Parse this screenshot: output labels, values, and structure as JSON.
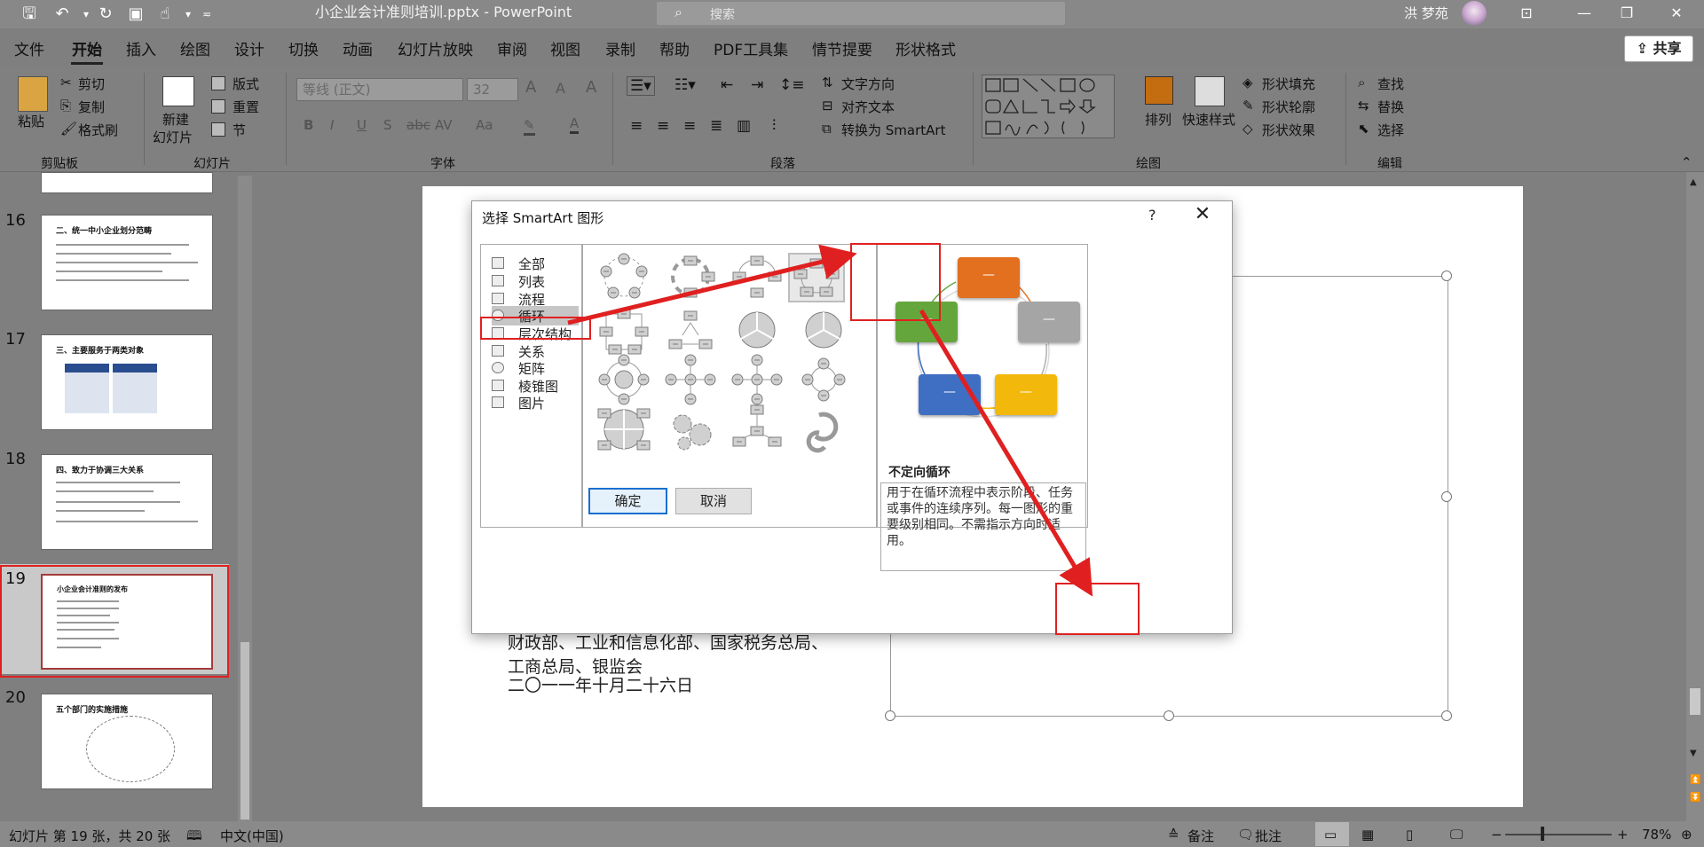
{
  "titlebar": {
    "doc_title": "小企业会计准则培训.pptx  -  PowerPoint",
    "search_placeholder": "搜索",
    "user_name": "洪 梦苑"
  },
  "menu": {
    "items": [
      "文件",
      "开始",
      "插入",
      "绘图",
      "设计",
      "切换",
      "动画",
      "幻灯片放映",
      "审阅",
      "视图",
      "录制",
      "帮助",
      "PDF工具集",
      "情节提要",
      "形状格式"
    ],
    "active": "开始",
    "share": "共享"
  },
  "ribbon": {
    "clipboard": {
      "paste": "粘贴",
      "cut": "剪切",
      "copy": "复制",
      "format_painter": "格式刷",
      "group": "剪贴板"
    },
    "slides": {
      "new_slide_1": "新建",
      "new_slide_2": "幻灯片",
      "layout": "版式",
      "reset": "重置",
      "section": "节",
      "group": "幻灯片"
    },
    "font": {
      "font_name": "等线 (正文)",
      "font_size": "32",
      "group": "字体"
    },
    "paragraph": {
      "text_direction": "文字方向",
      "align_text": "对齐文本",
      "convert_smartart": "转换为 SmartArt",
      "group": "段落"
    },
    "drawing": {
      "arrange": "排列",
      "quick_styles": "快速样式",
      "shape_fill": "形状填充",
      "shape_outline": "形状轮廓",
      "shape_effects": "形状效果",
      "group": "绘图"
    },
    "editing": {
      "find": "查找",
      "replace": "替换",
      "select": "选择",
      "group": "编辑"
    }
  },
  "thumbnails": [
    {
      "num": "16",
      "title": "二、统一中小企业划分范畴"
    },
    {
      "num": "17",
      "title": "三、主要服务于两类对象"
    },
    {
      "num": "18",
      "title": "四、致力于协调三大关系"
    },
    {
      "num": "19",
      "title": "小企业会计准则的发布"
    },
    {
      "num": "20",
      "title": "五个部门的实施措施"
    }
  ],
  "slide": {
    "line1": "财政部、工业和信息化部、国家税务总局、",
    "line1b": "工商总局、银监会",
    "line2": "二〇一一年十月二十六日"
  },
  "dialog": {
    "title": "选择 SmartArt 图形",
    "help": "?",
    "categories": [
      "全部",
      "列表",
      "流程",
      "循环",
      "层次结构",
      "关系",
      "矩阵",
      "棱锥图",
      "图片"
    ],
    "selected_category": "循环",
    "preview_title": "不定向循环",
    "preview_desc": "用于在循环流程中表示阶段、任务或事件的连续序列。每一图形的重要级别相同。不需指示方向时适用。",
    "box_text": "—",
    "ok": "确定",
    "cancel": "取消"
  },
  "status": {
    "slide_info": "幻灯片 第 19 张，共 20 张",
    "language": "中文(中国)",
    "notes": "备注",
    "comments": "批注",
    "zoom": "78%"
  },
  "colors": {
    "box_orange": "#e2701f",
    "box_gray": "#a5a5a5",
    "box_yellow": "#f2b90c",
    "box_blue": "#3f6fc2",
    "box_green": "#65a63c",
    "highlight_red": "#e02020"
  }
}
